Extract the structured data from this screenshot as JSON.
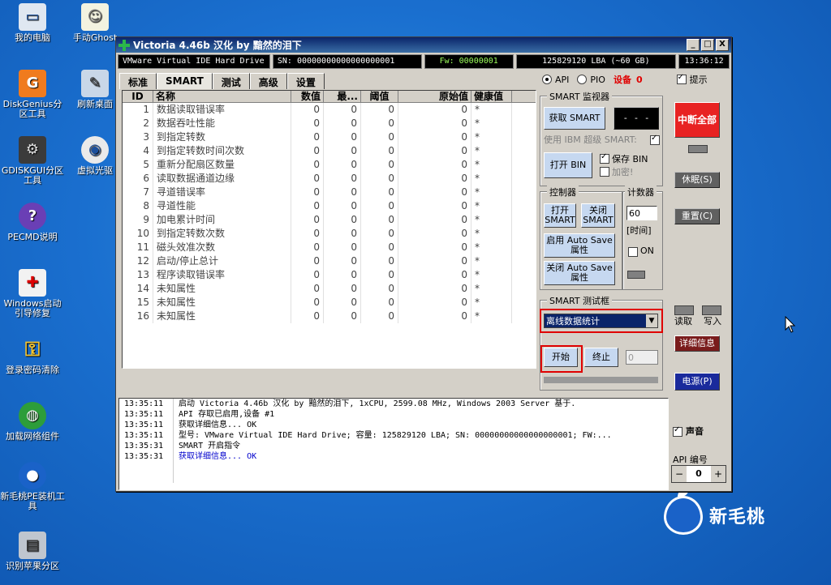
{
  "desktop": {
    "icons": [
      {
        "label": "我的电脑",
        "icon": "computer-icon"
      },
      {
        "label": "手动Ghost",
        "icon": "ghost-icon"
      },
      {
        "label": "DiskGenius分区工具",
        "icon": "diskgenius-icon"
      },
      {
        "label": "刷新桌面",
        "icon": "refresh-desktop-icon"
      },
      {
        "label": "GDISKGUI分区工具",
        "icon": "gdiskgui-icon"
      },
      {
        "label": "虚拟光驱",
        "icon": "virtual-drive-icon"
      },
      {
        "label": "PECMD说明",
        "icon": "help-icon"
      },
      {
        "label": "Windows启动引导修复",
        "icon": "boot-repair-icon"
      },
      {
        "label": "登录密码清除",
        "icon": "key-icon"
      },
      {
        "label": "加载网络组件",
        "icon": "network-icon"
      },
      {
        "label": "新毛桃PE装机工具",
        "icon": "peach-installer-icon"
      },
      {
        "label": "识别苹果分区",
        "icon": "apple-partition-icon"
      }
    ],
    "brand": "新毛桃"
  },
  "window": {
    "title": "Victoria 4.46b 汉化 by 黯然的泪下",
    "controls": [
      "_",
      "□",
      "X"
    ],
    "info": {
      "device": "VMware Virtual IDE Hard Drive",
      "sn": "SN: 00000000000000000001",
      "fw": "Fw: 00000001",
      "lba": "125829120 LBA (~60 GB)",
      "time": "13:36:12"
    },
    "tabs": [
      "标准",
      "SMART",
      "测试",
      "高级",
      "设置"
    ],
    "active_tab": "SMART",
    "mode": {
      "api": "API",
      "pio": "PIO",
      "device_label": "设备",
      "device_num": "0",
      "hint_label": "提示"
    },
    "table": {
      "headers": [
        "ID",
        "名称",
        "数值",
        "最...",
        "阈值",
        "原始值",
        "健康值"
      ],
      "rows": [
        {
          "id": "1",
          "name": "数据读取错误率",
          "val": "0",
          "worst": "0",
          "thr": "0",
          "raw": "0",
          "health": "*"
        },
        {
          "id": "2",
          "name": "数据吞吐性能",
          "val": "0",
          "worst": "0",
          "thr": "0",
          "raw": "0",
          "health": "*"
        },
        {
          "id": "3",
          "name": "到指定转数",
          "val": "0",
          "worst": "0",
          "thr": "0",
          "raw": "0",
          "health": "*"
        },
        {
          "id": "4",
          "name": "到指定转数时间次数",
          "val": "0",
          "worst": "0",
          "thr": "0",
          "raw": "0",
          "health": "*"
        },
        {
          "id": "5",
          "name": "重新分配扇区数量",
          "val": "0",
          "worst": "0",
          "thr": "0",
          "raw": "0",
          "health": "*"
        },
        {
          "id": "6",
          "name": "读取数据通道边缘",
          "val": "0",
          "worst": "0",
          "thr": "0",
          "raw": "0",
          "health": "*"
        },
        {
          "id": "7",
          "name": "寻道错误率",
          "val": "0",
          "worst": "0",
          "thr": "0",
          "raw": "0",
          "health": "*"
        },
        {
          "id": "8",
          "name": "寻道性能",
          "val": "0",
          "worst": "0",
          "thr": "0",
          "raw": "0",
          "health": "*"
        },
        {
          "id": "9",
          "name": "加电累计时间",
          "val": "0",
          "worst": "0",
          "thr": "0",
          "raw": "0",
          "health": "*"
        },
        {
          "id": "10",
          "name": "到指定转数次数",
          "val": "0",
          "worst": "0",
          "thr": "0",
          "raw": "0",
          "health": "*"
        },
        {
          "id": "11",
          "name": "磁头效准次数",
          "val": "0",
          "worst": "0",
          "thr": "0",
          "raw": "0",
          "health": "*"
        },
        {
          "id": "12",
          "name": "启动/停止总计",
          "val": "0",
          "worst": "0",
          "thr": "0",
          "raw": "0",
          "health": "*"
        },
        {
          "id": "13",
          "name": "程序读取错误率",
          "val": "0",
          "worst": "0",
          "thr": "0",
          "raw": "0",
          "health": "*"
        },
        {
          "id": "14",
          "name": "未知属性",
          "val": "0",
          "worst": "0",
          "thr": "0",
          "raw": "0",
          "health": "*"
        },
        {
          "id": "15",
          "name": "未知属性",
          "val": "0",
          "worst": "0",
          "thr": "0",
          "raw": "0",
          "health": "*"
        },
        {
          "id": "16",
          "name": "未知属性",
          "val": "0",
          "worst": "0",
          "thr": "0",
          "raw": "0",
          "health": "*"
        }
      ]
    },
    "smart_monitor": {
      "title": "SMART 监视器",
      "get_btn": "获取 SMART",
      "display": "- - -",
      "use_label": "使用 IBM 超级 SMART:",
      "open_bin": "打开 BIN",
      "save_bin": "保存 BIN",
      "encrypt": "加密!"
    },
    "controller": {
      "title": "控制器",
      "open_smart": "打开 SMART",
      "close_smart": "关闭 SMART",
      "enable_autosave": "启用 Auto Save 属性",
      "disable_autosave": "关闭 Auto Save 属性"
    },
    "counter": {
      "title": "计数器",
      "value": "60",
      "unit": "[时间]",
      "on_label": "ON"
    },
    "smart_test": {
      "title": "SMART 测试框",
      "selected": "离线数据统计",
      "start": "开始",
      "stop": "终止",
      "progress_value": "0"
    },
    "right": {
      "stop_all": "中断全部",
      "sleep": "休眠(S)",
      "reset": "重置(C)",
      "read": "读取",
      "write": "写入",
      "details": "详细信息",
      "power": "电源(P)",
      "sound": "声音",
      "api_num_label": "API 编号",
      "api_num": "0",
      "minus": "−",
      "plus": "+"
    },
    "log": [
      {
        "time": "13:35:11",
        "msg": "启动 Victoria 4.46b 汉化 by 黯然的泪下, 1xCPU, 2599.08 MHz, Windows 2003 Server 基于.",
        "blue": false
      },
      {
        "time": "13:35:11",
        "msg": "API 存取已启用,设备 #1",
        "blue": false
      },
      {
        "time": "13:35:11",
        "msg": "获取详细信息... OK",
        "blue": false
      },
      {
        "time": "13:35:11",
        "msg": "型号:  VMware Virtual IDE Hard Drive;     容量: 125829120 LBA; SN: 00000000000000000001; FW:...",
        "blue": false
      },
      {
        "time": "13:35:31",
        "msg": "SMART 开启指令",
        "blue": false
      },
      {
        "time": "13:35:31",
        "msg": "获取详细信息... OK",
        "blue": true
      }
    ]
  }
}
